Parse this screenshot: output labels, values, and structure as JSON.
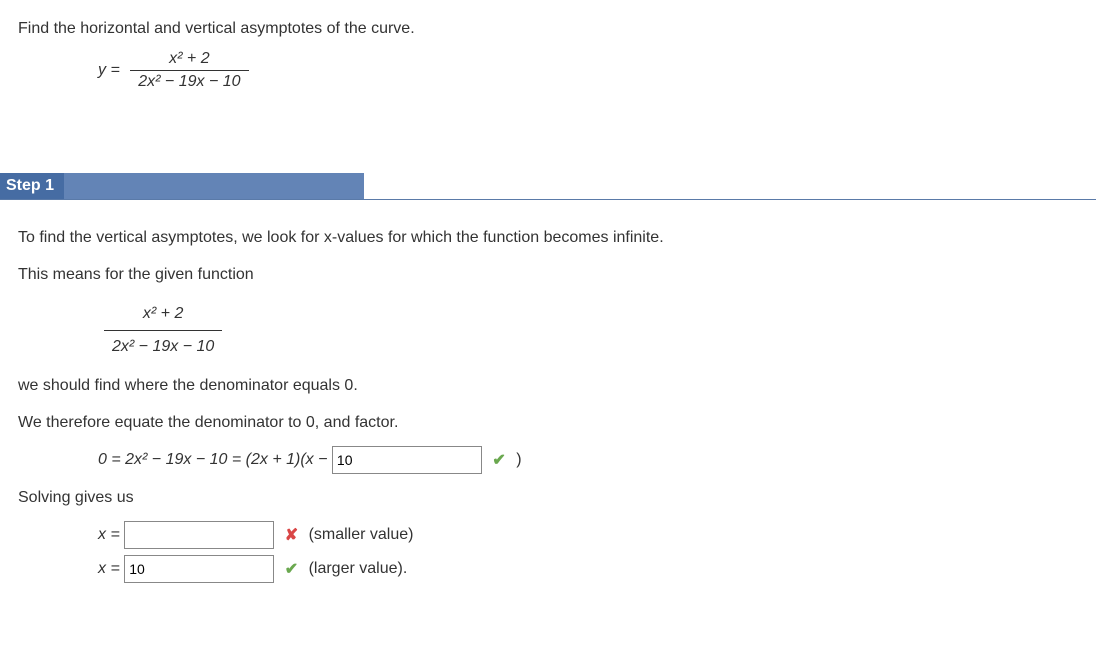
{
  "question": {
    "prompt": "Find the horizontal and vertical asymptotes of the curve.",
    "lhs": "y =",
    "numerator": "x² + 2",
    "denominator": "2x² − 19x − 10"
  },
  "step": {
    "label": "Step 1",
    "line1": "To find the vertical asymptotes, we look for x-values for which the function becomes infinite.",
    "line2": "This means for the given function",
    "frac": {
      "numerator": "x² + 2",
      "denominator": "2x² − 19x − 10"
    },
    "line3": "we should find where the denominator equals 0.",
    "line4": "We therefore equate the denominator to 0, and factor.",
    "equation": {
      "lead": "0 = 2x² − 19x − 10 = (2x + 1)(x − ",
      "input1_value": "10",
      "close": ")"
    },
    "line5": "Solving gives us",
    "solve": {
      "varlabel": "x =",
      "smaller_value": "",
      "smaller_hint": "(smaller value)",
      "larger_value": "10",
      "larger_hint": "(larger value)."
    }
  }
}
